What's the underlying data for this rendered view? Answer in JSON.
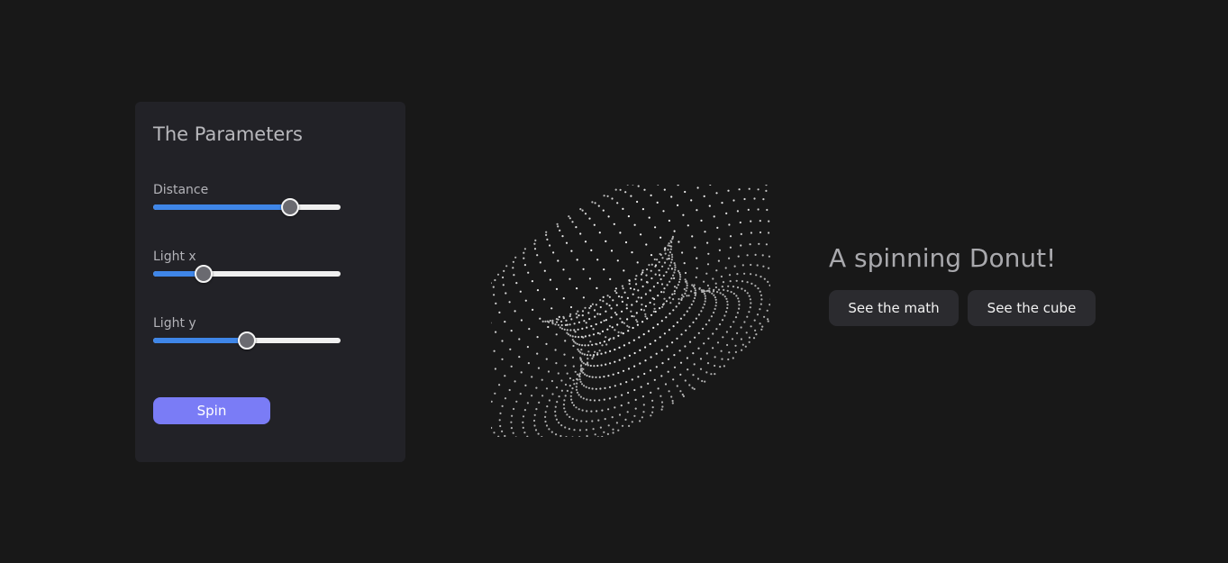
{
  "panel": {
    "title": "The Parameters",
    "sliders": [
      {
        "label": "Distance",
        "value": 0.73
      },
      {
        "label": "Light x",
        "value": 0.27
      },
      {
        "label": "Light y",
        "value": 0.5
      }
    ],
    "spin_label": "Spin"
  },
  "main": {
    "headline": "A spinning Donut!",
    "math_button": "See the math",
    "cube_button": "See the cube"
  },
  "colors": {
    "background": "#181818",
    "panel": "#222227",
    "accent": "#3f86e8",
    "spin_button": "#7a7cf6",
    "secondary_button": "#2b2b2f"
  },
  "icons": {
    "donut": "donut-point-cloud"
  }
}
